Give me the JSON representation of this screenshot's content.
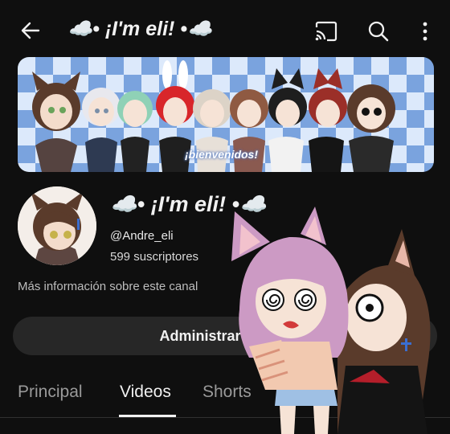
{
  "header": {
    "title": "☁️• ¡I'm eli! •☁️",
    "icons": [
      "back-arrow-icon",
      "cast-icon",
      "search-icon",
      "more-vert-icon"
    ]
  },
  "banner": {
    "tag": "¡bienvenidos!"
  },
  "channel": {
    "name": "☁️• ¡I'm eli! •☁️",
    "handle": "@Andre_eli",
    "subscribers": "599 suscriptores",
    "more_info": "Más información sobre este canal",
    "manage_button": "Administrar videos"
  },
  "tabs": [
    {
      "label": "Principal",
      "active": false
    },
    {
      "label": "Videos",
      "active": true
    },
    {
      "label": "Shorts",
      "active": false
    }
  ],
  "colors": {
    "background": "#0f0f0f",
    "button": "#272727",
    "banner_light": "#dce9fb",
    "banner_dark": "#7aa3de"
  }
}
